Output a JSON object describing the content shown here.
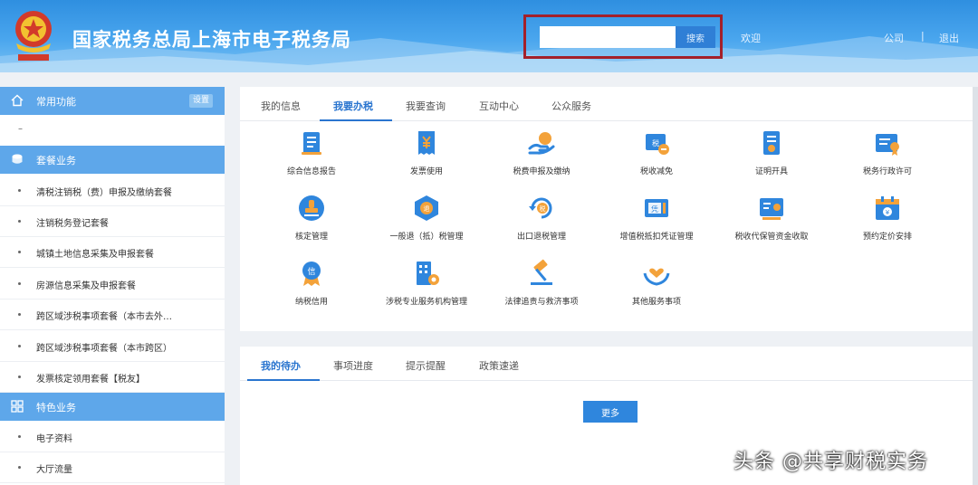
{
  "header": {
    "title": "国家税务总局上海市电子税务局",
    "search": {
      "placeholder": "",
      "button_label": "搜索"
    },
    "welcome": "欢迎",
    "user_link": "公司",
    "separator": "|",
    "logout": "退出"
  },
  "sidebar": {
    "common": {
      "label": "常用功能",
      "settings": "设置",
      "empty_placeholder": "–"
    },
    "view_section": {
      "label": "套餐业务",
      "items": [
        "清税注销税（费）申报及缴纳套餐",
        "注销税务登记套餐",
        "城镇土地信息采集及申报套餐",
        "房源信息采集及申报套餐",
        "跨区域涉税事项套餐（本市去外…",
        "跨区域涉税事项套餐（本市跨区）",
        "发票核定领用套餐【税友】"
      ]
    },
    "special_section": {
      "label": "特色业务",
      "items": [
        "电子资料",
        "大厅流量"
      ]
    }
  },
  "main": {
    "tabs": [
      "我的信息",
      "我要办税",
      "我要查询",
      "互动中心",
      "公众服务"
    ],
    "active_tab": 1,
    "services": [
      {
        "label": "综合信息报告",
        "icon": "report-icon"
      },
      {
        "label": "发票使用",
        "icon": "invoice-icon"
      },
      {
        "label": "税费申报及缴纳",
        "icon": "payment-icon"
      },
      {
        "label": "税收减免",
        "icon": "tax-relief-icon"
      },
      {
        "label": "证明开具",
        "icon": "certificate-icon"
      },
      {
        "label": "税务行政许可",
        "icon": "permit-icon"
      },
      {
        "label": "核定管理",
        "icon": "stamp-icon"
      },
      {
        "label": "一般退（抵）税管理",
        "icon": "refund-icon"
      },
      {
        "label": "出口退税管理",
        "icon": "export-refund-icon"
      },
      {
        "label": "增值税抵扣凭证管理",
        "icon": "voucher-icon"
      },
      {
        "label": "税收代保管资金收取",
        "icon": "custody-fund-icon"
      },
      {
        "label": "预约定价安排",
        "icon": "calendar-icon"
      },
      {
        "label": "纳税信用",
        "icon": "credit-medal-icon"
      },
      {
        "label": "涉税专业服务机构管理",
        "icon": "agency-icon"
      },
      {
        "label": "法律追责与救济事项",
        "icon": "gavel-icon"
      },
      {
        "label": "其他服务事项",
        "icon": "heart-hands-icon"
      }
    ]
  },
  "bottom": {
    "tabs": [
      "我的待办",
      "事项进度",
      "提示提醒",
      "政策速递"
    ],
    "active_tab": 0,
    "more_label": "更多"
  },
  "watermark": "头条 @共享财税实务",
  "colors": {
    "header_blue": "#3f9be9",
    "accent_blue": "#2a75cf",
    "sidebar_section": "#5ea7ea",
    "highlight_red": "#a3202a",
    "icon_blue": "#2f86dd",
    "icon_orange": "#f3a23a"
  }
}
